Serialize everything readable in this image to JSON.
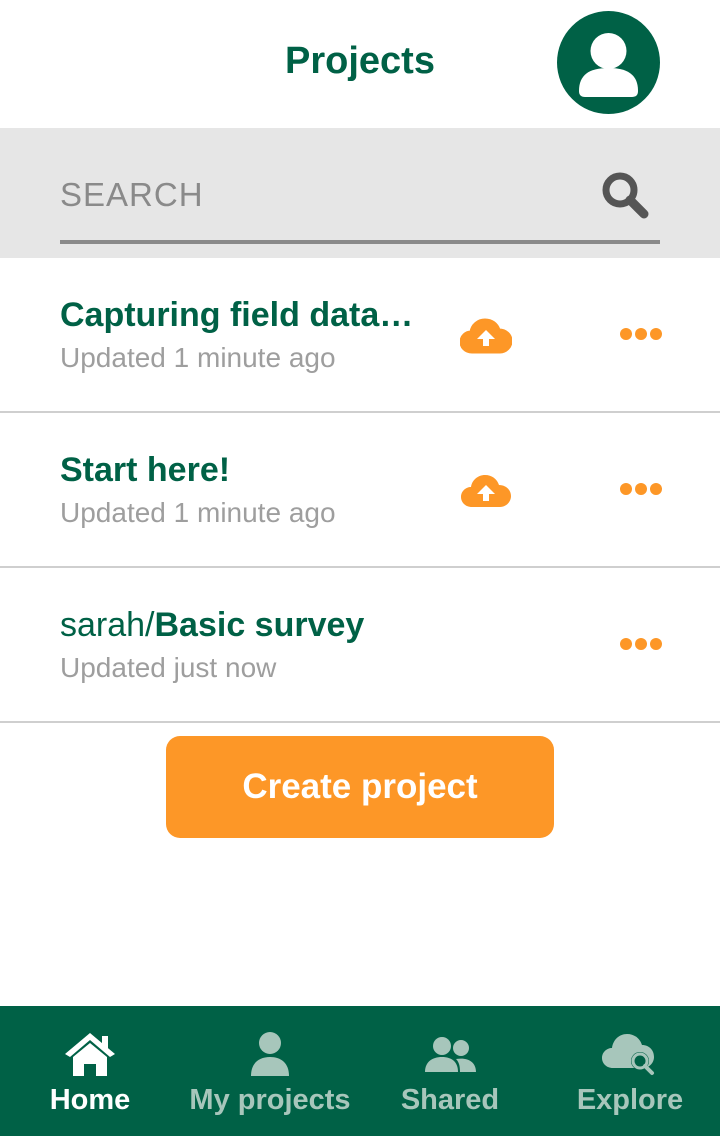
{
  "header": {
    "title": "Projects"
  },
  "search": {
    "placeholder": "SEARCH",
    "value": ""
  },
  "projects": [
    {
      "namespace": "",
      "name": "Capturing field data with Mergin Maps",
      "display_name": "Capturing field data…",
      "updated": "Updated 1 minute ago",
      "has_upload": true
    },
    {
      "namespace": "",
      "name": "Start here!",
      "updated": "Updated 1 minute ago",
      "has_upload": true
    },
    {
      "namespace": "sarah/",
      "name": "Basic survey",
      "updated": "Updated just now",
      "has_upload": false
    }
  ],
  "create_button": {
    "label": "Create project"
  },
  "nav": {
    "items": [
      {
        "label": "Home",
        "icon": "home-icon",
        "active": true
      },
      {
        "label": "My projects",
        "icon": "person-icon",
        "active": false
      },
      {
        "label": "Shared",
        "icon": "people-icon",
        "active": false
      },
      {
        "label": "Explore",
        "icon": "cloud-search-icon",
        "active": false
      }
    ]
  },
  "colors": {
    "brand_green": "#006146",
    "accent_orange": "#fd9727",
    "muted_text": "#9e9e9e",
    "search_bg": "#e6e6e6",
    "nav_inactive": "#a7c6bb"
  }
}
